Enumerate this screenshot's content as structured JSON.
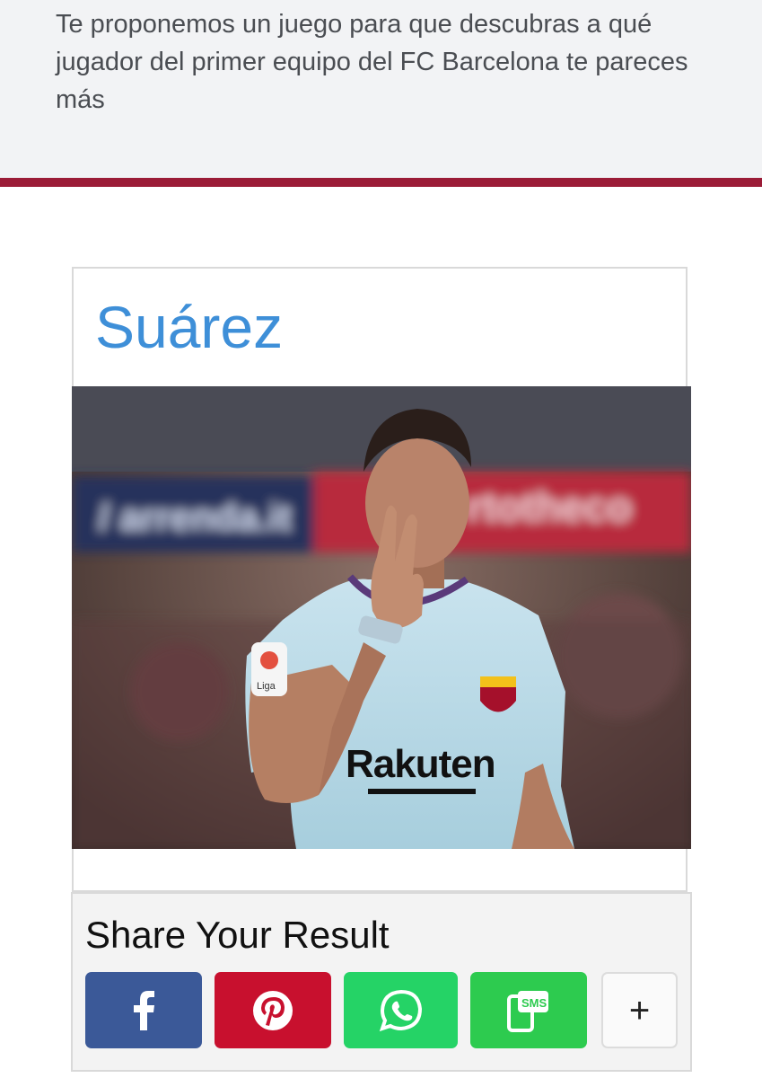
{
  "intro": {
    "text": "Te proponemos un juego para que descubras a qué jugador del primer equipo del FC Barcelona te pareces más"
  },
  "colors": {
    "accent_rule": "#9b1c37",
    "title": "#3e8fd8",
    "facebook": "#3b5998",
    "pinterest": "#c8102e",
    "whatsapp": "#25d366",
    "sms": "#2dcb4f"
  },
  "result": {
    "title": "Suárez",
    "photo_text": {
      "sponsor": "Rakuten",
      "league_patch": "Liga"
    }
  },
  "share": {
    "title": "Share Your Result",
    "buttons": [
      {
        "id": "facebook",
        "icon": "facebook-icon"
      },
      {
        "id": "pinterest",
        "icon": "pinterest-icon"
      },
      {
        "id": "whatsapp",
        "icon": "whatsapp-icon"
      },
      {
        "id": "sms",
        "icon": "sms-icon",
        "label": "SMS"
      },
      {
        "id": "more",
        "icon": "plus-icon",
        "label": "+"
      }
    ]
  }
}
